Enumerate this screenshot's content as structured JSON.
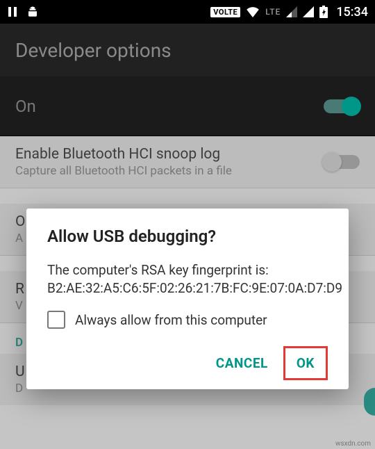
{
  "status": {
    "clock": "15:34",
    "volte": "VOLTE",
    "lte": "LTE"
  },
  "header": {
    "title": "Developer options"
  },
  "master": {
    "label": "On"
  },
  "items": {
    "bt_snoop": {
      "title": "Enable Bluetooth HCI snoop log",
      "sub": "Capture all Bluetooth HCI packets in a file"
    },
    "oem": {
      "title": "O",
      "sub": "A"
    },
    "running": {
      "title": "R",
      "sub": "V"
    },
    "category_d": "D",
    "usb": {
      "title": "U",
      "sub": "D"
    }
  },
  "dialog": {
    "title": "Allow USB debugging?",
    "body": "The computer's RSA key fingerprint is:\nB2:AE:32:A5:C6:5F:02:26:21:7B:FC:9E:07:0A:D7:D9",
    "checkbox_label": "Always allow from this computer",
    "cancel": "CANCEL",
    "ok": "OK"
  },
  "watermark": "wsxdn.com"
}
